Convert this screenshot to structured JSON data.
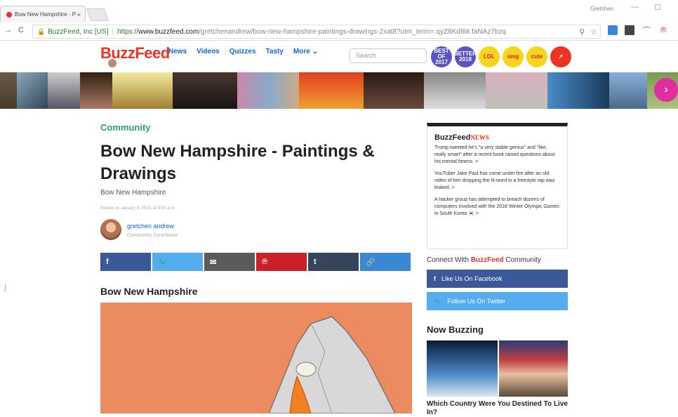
{
  "browser": {
    "tab_title": "Bow New Hampshire - P",
    "tab_close": "×",
    "user": "Gretchen",
    "min": "—",
    "max": "☐",
    "back": "→",
    "reload": "C",
    "org": "BuzzFeed, Inc [US]",
    "scheme": "https://",
    "host": "www.buzzfeed.com",
    "path": "/gretchenandrew/bow-new-hampshire-paintings-drawings-2xat8?utm_term=.qyZ8Kd8l#.faNAz7bzq",
    "zoom_icon": "⚲",
    "star_icon": "☆"
  },
  "site": {
    "logo": "BuzzFeed",
    "nav": [
      "News",
      "Videos",
      "Quizzes",
      "Tasty",
      "More ⌄"
    ],
    "search_placeholder": "Search",
    "badges": [
      {
        "text": "BEST OF 2017",
        "bg": "#5a54c4",
        "fg": "#fff"
      },
      {
        "text": "BETTER 2018",
        "bg": "#5a54c4",
        "fg": "#fff"
      },
      {
        "text": "LOL",
        "bg": "#f7d41e",
        "fg": "#e02222"
      },
      {
        "text": "omg",
        "bg": "#f7d41e",
        "fg": "#e02222"
      },
      {
        "text": "cute",
        "bg": "#f7d41e",
        "fg": "#e02222"
      },
      {
        "text": "↗",
        "bg": "#ee3322",
        "fg": "#fff"
      }
    ],
    "next_arrow": "›"
  },
  "article": {
    "category": "Community",
    "title": "Bow New Hampshire - Paintings & Drawings",
    "subtitle": "Bow New Hampshire",
    "posted": "Posted on January 6, 2018, at 9:50 a.m.",
    "author_name": "gretchen andrew",
    "author_role": "Community Contributor",
    "section_heading": "Bow New Hampshire",
    "share": [
      {
        "icon": "f",
        "bg": "#3b5998"
      },
      {
        "icon": "🐦",
        "bg": "#55acee"
      },
      {
        "icon": "✉",
        "bg": "#5b5b5b"
      },
      {
        "icon": "℗",
        "bg": "#cb2027"
      },
      {
        "icon": "t",
        "bg": "#35465c"
      },
      {
        "icon": "🔗",
        "bg": "#3b87d4"
      }
    ]
  },
  "sidebar": {
    "news_logo": "BuzzFeed",
    "news_logo_suffix": "NEWS",
    "news_items": [
      "Trump tweeted he's \"a very stable genius\" and \"like, really smart\" after a recent book raised questions about his mental fitness. >",
      "YouTuber Jake Paul has come under fire after an old video of him dropping the N-word in a freestyle rap was leaked. >",
      "A hacker group has attempted to breach dozens of computers involved with the 2018 Winter Olympic Games in South Korea 🇰🇷 >"
    ],
    "connect_prefix": "Connect With ",
    "connect_brand": "BuzzFeed",
    "connect_suffix": " Community",
    "facebook_btn": "Like Us On Facebook",
    "twitter_btn": "Follow Us On Twitter",
    "now_buzzing": "Now Buzzing",
    "buzz_caption": "Which Country Were You Destined To Live In?"
  }
}
